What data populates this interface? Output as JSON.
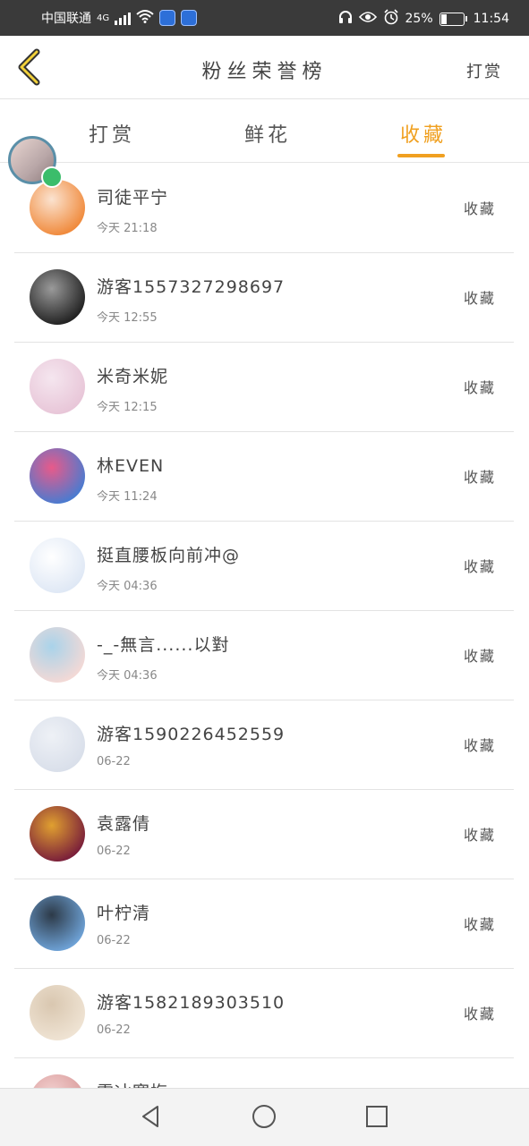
{
  "status_bar": {
    "carrier": "中国联通",
    "network": "4G",
    "battery_pct": "25%",
    "battery_level": 0.25,
    "time": "11:54"
  },
  "header": {
    "back_icon": "chevron-left-icon",
    "title": "粉丝荣誉榜",
    "tip_label": "打赏"
  },
  "tabs": [
    {
      "label": "打赏",
      "active": false
    },
    {
      "label": "鲜花",
      "active": false
    },
    {
      "label": "收藏",
      "active": true
    }
  ],
  "accent_color": "#f0a020",
  "list": [
    {
      "name": "司徒平宁",
      "time": "今天 21:18",
      "action": "收藏",
      "avatar_colors": [
        "#f08a3c",
        "#fbe3d0"
      ]
    },
    {
      "name": "游客1557327298697",
      "time": "今天 12:55",
      "action": "收藏",
      "avatar_colors": [
        "#222222",
        "#9a9a9a"
      ]
    },
    {
      "name": "米奇米妮",
      "time": "今天 12:15",
      "action": "收藏",
      "avatar_colors": [
        "#e8c6d8",
        "#f5e6ef"
      ]
    },
    {
      "name": "林EVEN",
      "time": "今天 11:24",
      "action": "收藏",
      "avatar_colors": [
        "#4a7bd0",
        "#e85a8a"
      ]
    },
    {
      "name": "挺直腰板向前冲@",
      "time": "今天 04:36",
      "action": "收藏",
      "avatar_colors": [
        "#dfe8f5",
        "#ffffff"
      ]
    },
    {
      "name": "-_-無言......以對",
      "time": "今天 04:36",
      "action": "收藏",
      "avatar_colors": [
        "#f3d9d6",
        "#a9d3ea"
      ]
    },
    {
      "name": "游客1590226452559",
      "time": "06-22",
      "action": "收藏",
      "avatar_colors": [
        "#d9dfea",
        "#eef1f6"
      ]
    },
    {
      "name": "袁露倩",
      "time": "06-22",
      "action": "收藏",
      "avatar_colors": [
        "#7a1f3a",
        "#e0a030"
      ]
    },
    {
      "name": "叶柠清",
      "time": "06-22",
      "action": "收藏",
      "avatar_colors": [
        "#6ea2d6",
        "#2d3a48"
      ]
    },
    {
      "name": "游客1582189303510",
      "time": "06-22",
      "action": "收藏",
      "avatar_colors": [
        "#efe3d3",
        "#d9c7b0"
      ]
    },
    {
      "name": "雪冰寒梅",
      "time": "",
      "action": "",
      "avatar_colors": [
        "#d99a9a",
        "#f2d0cf"
      ]
    }
  ]
}
